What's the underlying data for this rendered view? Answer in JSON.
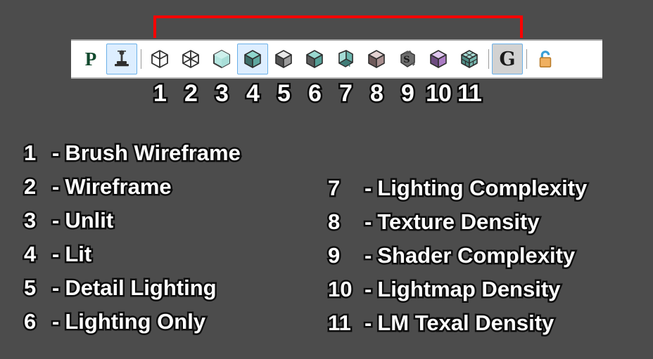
{
  "background_color": "#4c4c4c",
  "annotation": {
    "name": "red-bracket",
    "color": "#ff0000",
    "spans_items": "1-11"
  },
  "toolbar": {
    "items": [
      {
        "id": "p-button",
        "kind": "letter",
        "label": "P",
        "icon": "letter-p-icon",
        "selected": false
      },
      {
        "id": "lighting-tool",
        "kind": "icon",
        "label": "",
        "icon": "light-placement-icon",
        "selected": true
      },
      {
        "id": "sep-1",
        "kind": "separator"
      },
      {
        "id": "view-brush-wireframe",
        "kind": "icon",
        "label": "",
        "icon": "brush-wireframe-cube-icon",
        "selected": false,
        "number": "1"
      },
      {
        "id": "view-wireframe",
        "kind": "icon",
        "label": "",
        "icon": "wireframe-cube-icon",
        "selected": false,
        "number": "2"
      },
      {
        "id": "view-unlit",
        "kind": "icon",
        "label": "",
        "icon": "unlit-cube-icon",
        "selected": false,
        "number": "3"
      },
      {
        "id": "view-lit",
        "kind": "icon",
        "label": "",
        "icon": "lit-cube-icon",
        "selected": true,
        "number": "4"
      },
      {
        "id": "view-detail-lighting",
        "kind": "icon",
        "label": "",
        "icon": "detail-lighting-cube-icon",
        "selected": false,
        "number": "5"
      },
      {
        "id": "view-lighting-only",
        "kind": "icon",
        "label": "",
        "icon": "lighting-only-cube-icon",
        "selected": false,
        "number": "6"
      },
      {
        "id": "view-lighting-complexity",
        "kind": "icon",
        "label": "",
        "icon": "lighting-complexity-icon",
        "selected": false,
        "number": "7"
      },
      {
        "id": "view-texture-density",
        "kind": "icon",
        "label": "",
        "icon": "texture-density-cube-icon",
        "selected": false,
        "number": "8"
      },
      {
        "id": "view-shader-complexity",
        "kind": "icon",
        "label": "",
        "icon": "shader-complexity-icon",
        "selected": false,
        "number": "9"
      },
      {
        "id": "view-lightmap-density",
        "kind": "icon",
        "label": "",
        "icon": "lightmap-density-cube-icon",
        "selected": false,
        "number": "10"
      },
      {
        "id": "view-lm-texel-density",
        "kind": "icon",
        "label": "",
        "icon": "lm-texel-density-cube-icon",
        "selected": false,
        "number": "11"
      },
      {
        "id": "sep-2",
        "kind": "separator"
      },
      {
        "id": "game-view-toggle",
        "kind": "letter",
        "label": "G",
        "icon": "letter-g-icon",
        "selected": true
      },
      {
        "id": "sep-3",
        "kind": "separator"
      },
      {
        "id": "lock-button",
        "kind": "icon",
        "label": "",
        "icon": "lock-icon",
        "selected": false
      }
    ],
    "numbers": [
      "1",
      "2",
      "3",
      "4",
      "5",
      "6",
      "7",
      "8",
      "9",
      "10",
      "11"
    ]
  },
  "legend": {
    "left": [
      {
        "num": "1",
        "dash": "-",
        "text": "Brush Wireframe"
      },
      {
        "num": "2",
        "dash": "-",
        "text": "Wireframe"
      },
      {
        "num": "3",
        "dash": "-",
        "text": "Unlit"
      },
      {
        "num": "4",
        "dash": "-",
        "text": "Lit"
      },
      {
        "num": "5",
        "dash": "-",
        "text": "Detail Lighting"
      },
      {
        "num": "6",
        "dash": "-",
        "text": "Lighting Only"
      }
    ],
    "right": [
      {
        "num": "7",
        "dash": "-",
        "text": "Lighting Complexity"
      },
      {
        "num": "8",
        "dash": "-",
        "text": "Texture Density"
      },
      {
        "num": "9",
        "dash": "-",
        "text": "Shader Complexity"
      },
      {
        "num": "10",
        "dash": "-",
        "text": "Lightmap Density"
      },
      {
        "num": "11",
        "dash": "-",
        "text": "LM Texal Density"
      }
    ]
  }
}
